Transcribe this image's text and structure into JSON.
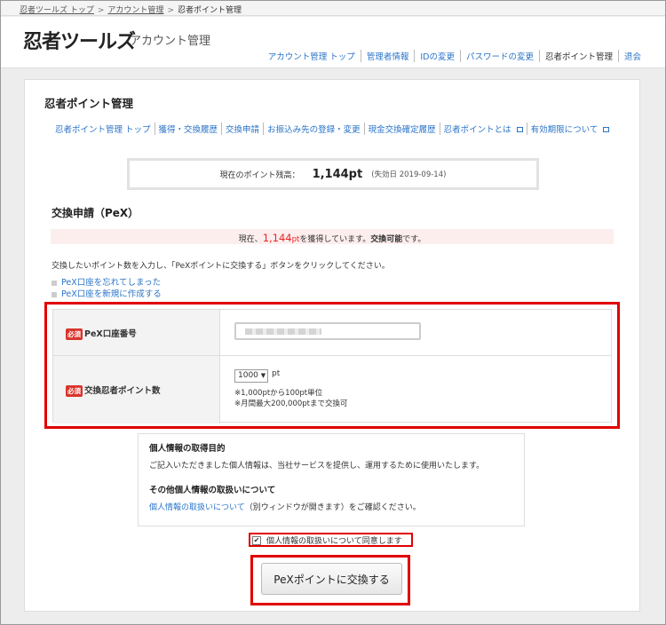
{
  "breadcrumb": {
    "items": [
      "忍者ツールズ トップ",
      "アカウント管理",
      "忍者ポイント管理"
    ],
    "sep": ">"
  },
  "header": {
    "logo": "忍者ツールズ",
    "subtitle": "アカウント管理",
    "nav": [
      "アカウント管理 トップ",
      "管理者情報",
      "IDの変更",
      "パスワードの変更",
      "忍者ポイント管理",
      "退会"
    ]
  },
  "page": {
    "title": "忍者ポイント管理",
    "subnav": [
      "忍者ポイント管理 トップ",
      "獲得・交換履歴",
      "交換申請",
      "お振込み先の登録・変更",
      "現金交換確定履歴",
      "忍者ポイントとは",
      "有効期限について"
    ]
  },
  "balance": {
    "label": "現在のポイント残高：",
    "value": "1,144pt",
    "expiry": "(失効日 2019-09-14)"
  },
  "exchange": {
    "title": "交換申請（PeX）",
    "status_prefix": "現在、",
    "status_points": "1,144",
    "status_unit": "pt",
    "status_mid": "を獲得しています。",
    "status_bold": "交換可能",
    "status_suffix": "です。",
    "instruction": "交換したいポイント数を入力し、「PeXポイントに交換する」ボタンをクリックしてください。",
    "links": [
      "PeX口座を忘れてしまった",
      "PeX口座を新規に作成する"
    ]
  },
  "form": {
    "required": "必須",
    "pex_label": "PeX口座番号",
    "points_label": "交換忍者ポイント数",
    "points_value": "1000",
    "points_unit": "pt",
    "note1": "※1,000ptから100pt単位",
    "note2": "※月間最大200,000ptまで交換可"
  },
  "privacy": {
    "h1": "個人情報の取得目的",
    "t1": "ご記入いただきました個人情報は、当社サービスを提供し、運用するために使用いたします。",
    "h2": "その他個人情報の取扱いについて",
    "link": "個人情報の取扱いについて",
    "t2": "（別ウィンドウが開きます）をご確認ください。"
  },
  "agree": {
    "label": "個人情報の取扱いについて同意します",
    "checked": true
  },
  "submit": {
    "label": "PeXポイントに交換する"
  }
}
